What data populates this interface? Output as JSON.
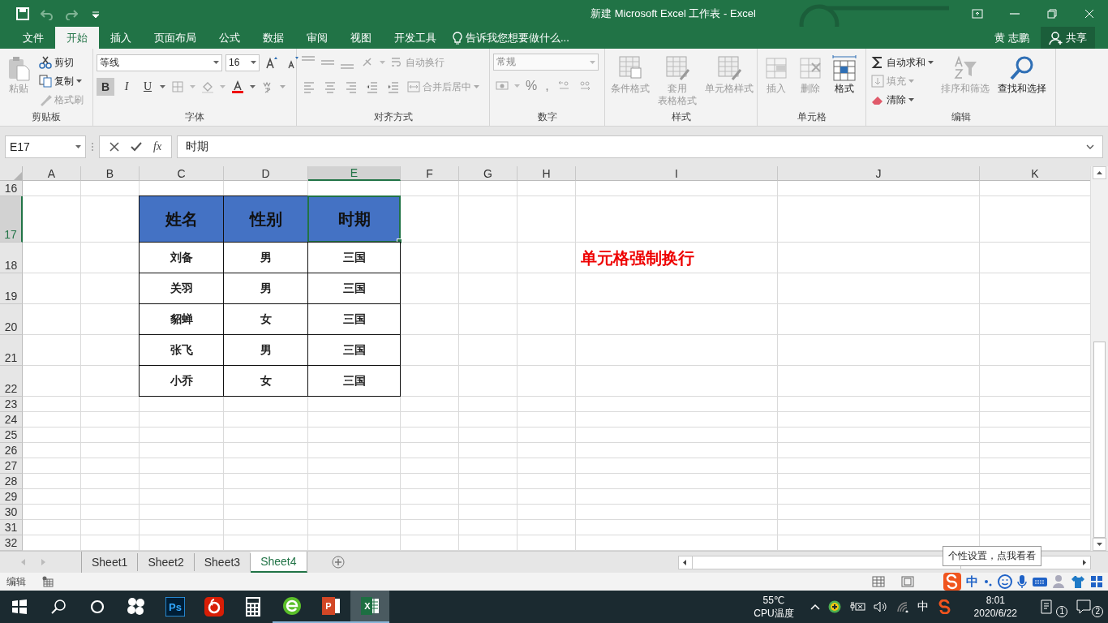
{
  "window": {
    "title": "新建 Microsoft Excel 工作表 - Excel"
  },
  "menu_tabs": [
    {
      "label": "文件",
      "selected": false
    },
    {
      "label": "开始",
      "selected": true
    },
    {
      "label": "插入",
      "selected": false
    },
    {
      "label": "页面布局",
      "selected": false
    },
    {
      "label": "公式",
      "selected": false
    },
    {
      "label": "数据",
      "selected": false
    },
    {
      "label": "审阅",
      "selected": false
    },
    {
      "label": "视图",
      "selected": false
    },
    {
      "label": "开发工具",
      "selected": false
    }
  ],
  "tell_me": {
    "placeholder": "告诉我您想要做什么..."
  },
  "user": "黄 志鹏",
  "share": "共享",
  "ribbon": [
    {
      "kind": "clipboard",
      "label": "剪贴板",
      "items": [
        {
          "label": "粘贴",
          "disabled": true
        },
        {
          "label": "剪切",
          "disabled": false
        },
        {
          "label": "复制",
          "disabled": false
        },
        {
          "label": "格式刷",
          "disabled": true
        }
      ]
    },
    {
      "kind": "font",
      "label": "字体",
      "font_name": "等线",
      "font_size": "16",
      "buttons": [
        {
          "label": "B",
          "pressed": true
        },
        {
          "label": "I",
          "pressed": false
        },
        {
          "label": "U",
          "pressed": false
        }
      ]
    },
    {
      "kind": "alignment",
      "label": "对齐方式",
      "items": [
        {
          "label": "自动换行",
          "disabled": true
        },
        {
          "label": "合并后居中",
          "disabled": true
        }
      ]
    },
    {
      "kind": "number",
      "label": "数字",
      "format": "常规",
      "symbols": [
        "%",
        ","
      ]
    },
    {
      "kind": "styles",
      "label": "样式",
      "items": [
        {
          "label": "条件格式",
          "disabled": true
        },
        {
          "label": "套用",
          "sublabel": "表格格式",
          "disabled": true
        },
        {
          "label": "单元格样式",
          "disabled": true
        }
      ]
    },
    {
      "kind": "cells",
      "label": "单元格",
      "items": [
        {
          "label": "插入",
          "disabled": true
        },
        {
          "label": "删除",
          "disabled": true
        },
        {
          "label": "格式",
          "disabled": false
        }
      ]
    },
    {
      "kind": "editing",
      "label": "编辑",
      "items": [
        {
          "label": "自动求和",
          "disabled": false
        },
        {
          "label": "填充",
          "disabled": true
        },
        {
          "label": "清除",
          "disabled": false
        },
        {
          "label": "排序和筛选",
          "disabled": true
        },
        {
          "label": "查找和选择",
          "disabled": false
        }
      ]
    }
  ],
  "formula_bar": {
    "name_box": "E17",
    "function_label": "fx",
    "formula": "时期"
  },
  "columns": [
    {
      "label": "A",
      "selected": false
    },
    {
      "label": "B",
      "selected": false
    },
    {
      "label": "C",
      "selected": false
    },
    {
      "label": "D",
      "selected": false
    },
    {
      "label": "E",
      "selected": true
    },
    {
      "label": "F",
      "selected": false
    },
    {
      "label": "G",
      "selected": false
    },
    {
      "label": "H",
      "selected": false
    },
    {
      "label": "I",
      "selected": false
    },
    {
      "label": "J",
      "selected": false
    },
    {
      "label": "K",
      "selected": false
    }
  ],
  "rows": [
    {
      "label": "16",
      "selected": false
    },
    {
      "label": "17",
      "selected": true
    },
    {
      "label": "18",
      "selected": false
    },
    {
      "label": "19",
      "selected": false
    },
    {
      "label": "20",
      "selected": false
    },
    {
      "label": "21",
      "selected": false
    },
    {
      "label": "22",
      "selected": false
    },
    {
      "label": "23",
      "selected": false
    },
    {
      "label": "24",
      "selected": false
    },
    {
      "label": "25",
      "selected": false
    },
    {
      "label": "26",
      "selected": false
    },
    {
      "label": "27",
      "selected": false
    },
    {
      "label": "28",
      "selected": false
    },
    {
      "label": "29",
      "selected": false
    },
    {
      "label": "30",
      "selected": false
    },
    {
      "label": "31",
      "selected": false
    },
    {
      "label": "32",
      "selected": false
    }
  ],
  "table": {
    "header": [
      {
        "text": "姓名",
        "active": false
      },
      {
        "text": "性别",
        "active": false
      },
      {
        "text": "时期",
        "active": true
      }
    ],
    "rows": [
      [
        "刘备",
        "男",
        "三国"
      ],
      [
        "关羽",
        "男",
        "三国"
      ],
      [
        "貂蝉",
        "女",
        "三国"
      ],
      [
        "张飞",
        "男",
        "三国"
      ],
      [
        "小乔",
        "女",
        "三国"
      ]
    ]
  },
  "note": "单元格强制换行",
  "sheets": [
    {
      "label": "Sheet1",
      "selected": false
    },
    {
      "label": "Sheet2",
      "selected": false
    },
    {
      "label": "Sheet3",
      "selected": false
    },
    {
      "label": "Sheet4",
      "selected": true
    }
  ],
  "status_bar": {
    "mode": "编辑"
  },
  "ime_toolbar": {
    "tooltip": "个性设置，点我看看",
    "language": "中"
  },
  "taskbar": {
    "apps": [
      {
        "kind": "pinwheel",
        "running": false,
        "active": false
      },
      {
        "kind": "photoshop",
        "glyph": "Ps",
        "running": false,
        "active": false
      },
      {
        "kind": "music",
        "running": false,
        "active": false
      },
      {
        "kind": "calculator",
        "running": false,
        "active": false
      },
      {
        "kind": "browser",
        "running": true,
        "active": false
      },
      {
        "kind": "powerpoint",
        "glyph": "P",
        "running": true,
        "active": false
      },
      {
        "kind": "excel",
        "glyph": "X",
        "running": true,
        "active": true
      }
    ]
  },
  "tray": {
    "temperature": "55℃",
    "temperature_label": "CPU温度",
    "language": "中",
    "time": "8:01",
    "date": "2020/6/22",
    "task_count": "1",
    "notification_count": "2"
  }
}
